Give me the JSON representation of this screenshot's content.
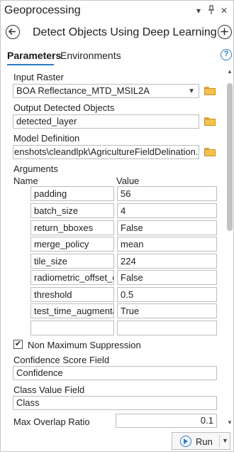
{
  "pane": {
    "title": "Geoprocessing",
    "menu_glyph": "▾",
    "pin_glyph": "📌",
    "close_glyph": "✕"
  },
  "tool": {
    "title": "Detect Objects Using Deep Learning",
    "back_icon": "back-arrow-icon",
    "add_icon": "plus-icon"
  },
  "tabs": [
    {
      "label": "Parameters",
      "active": true
    },
    {
      "label": "Environments",
      "active": false
    }
  ],
  "help_glyph": "?",
  "params": {
    "input_raster": {
      "label": "Input Raster",
      "value": "BOA Reflectance_MTD_MSIL2A"
    },
    "output_objects": {
      "label": "Output Detected Objects",
      "value": "detected_layer"
    },
    "model_definition": {
      "label": "Model Definition",
      "value": "enshots\\cleandlpk\\AgricultureFieldDelination.dlpk"
    },
    "arguments": {
      "label": "Arguments",
      "name_header": "Name",
      "value_header": "Value",
      "rows": [
        {
          "name": "padding",
          "value": "56"
        },
        {
          "name": "batch_size",
          "value": "4"
        },
        {
          "name": "return_bboxes",
          "value": "False"
        },
        {
          "name": "merge_policy",
          "value": "mean"
        },
        {
          "name": "tile_size",
          "value": "224"
        },
        {
          "name": "radiometric_offset_co",
          "value": "False"
        },
        {
          "name": "threshold",
          "value": "0.5"
        },
        {
          "name": "test_time_augmentati",
          "value": "True"
        },
        {
          "name": "",
          "value": ""
        }
      ]
    },
    "nms": {
      "label": "Non Maximum Suppression",
      "checked": true,
      "check_glyph": "✔"
    },
    "confidence_field": {
      "label": "Confidence Score Field",
      "value": "Confidence"
    },
    "class_field": {
      "label": "Class Value Field",
      "value": "Class"
    },
    "max_overlap": {
      "label": "Max Overlap Ratio",
      "value": "0.1"
    }
  },
  "run_button": {
    "label": "Run"
  },
  "colors": {
    "accent": "#2c7bc5",
    "folder": "#f3c14d"
  }
}
